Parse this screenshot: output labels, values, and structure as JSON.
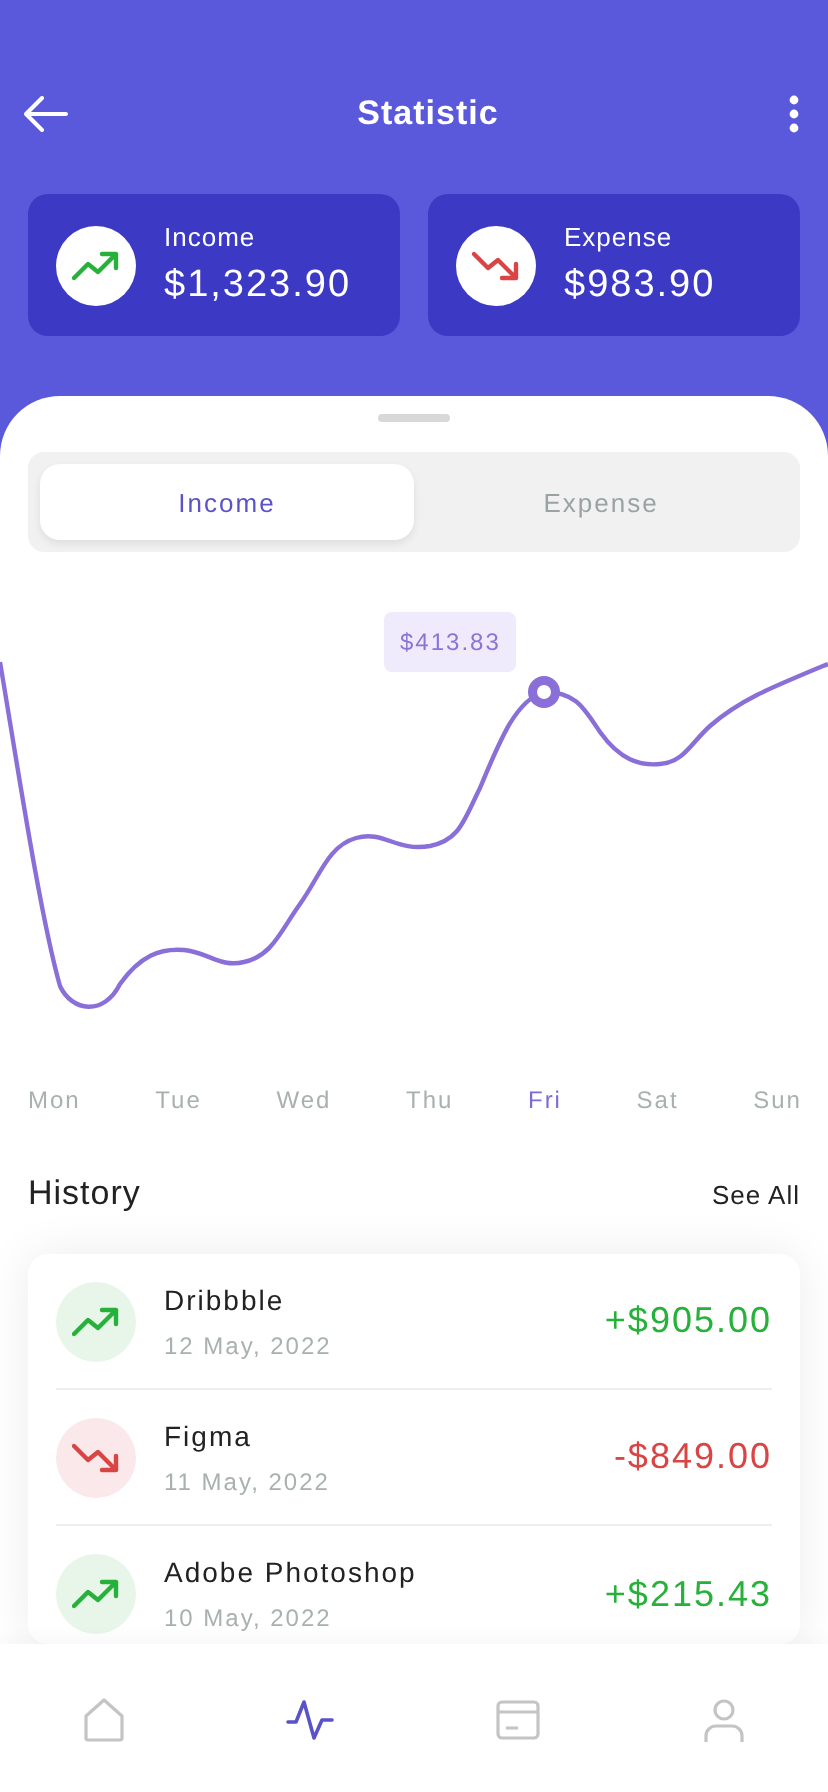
{
  "header": {
    "title": "Statistic"
  },
  "summary": [
    {
      "kind": "income",
      "label": "Income",
      "amount": "$1,323.90"
    },
    {
      "kind": "expense",
      "label": "Expense",
      "amount": "$983.90"
    }
  ],
  "tabs": [
    {
      "label": "Income",
      "selected": true
    },
    {
      "label": "Expense",
      "selected": false
    }
  ],
  "chart": {
    "tooltip": "$413.83",
    "days": [
      {
        "label": "Mon",
        "selected": false
      },
      {
        "label": "Tue",
        "selected": false
      },
      {
        "label": "Wed",
        "selected": false
      },
      {
        "label": "Thu",
        "selected": false
      },
      {
        "label": "Fri",
        "selected": true
      },
      {
        "label": "Sat",
        "selected": false
      },
      {
        "label": "Sun",
        "selected": false
      }
    ]
  },
  "history": {
    "title": "History",
    "link": "See All",
    "items": [
      {
        "kind": "income",
        "name": "Dribbble",
        "date": "12 May, 2022",
        "amount": "+$905.00"
      },
      {
        "kind": "expense",
        "name": "Figma",
        "date": "11 May, 2022",
        "amount": "-$849.00"
      },
      {
        "kind": "income",
        "name": "Adobe Photoshop",
        "date": "10 May, 2022",
        "amount": "+$215.43"
      }
    ]
  },
  "nav": [
    {
      "kind": "home",
      "selected": false
    },
    {
      "kind": "activity",
      "selected": true
    },
    {
      "kind": "card",
      "selected": false
    },
    {
      "kind": "profile",
      "selected": false
    }
  ]
}
